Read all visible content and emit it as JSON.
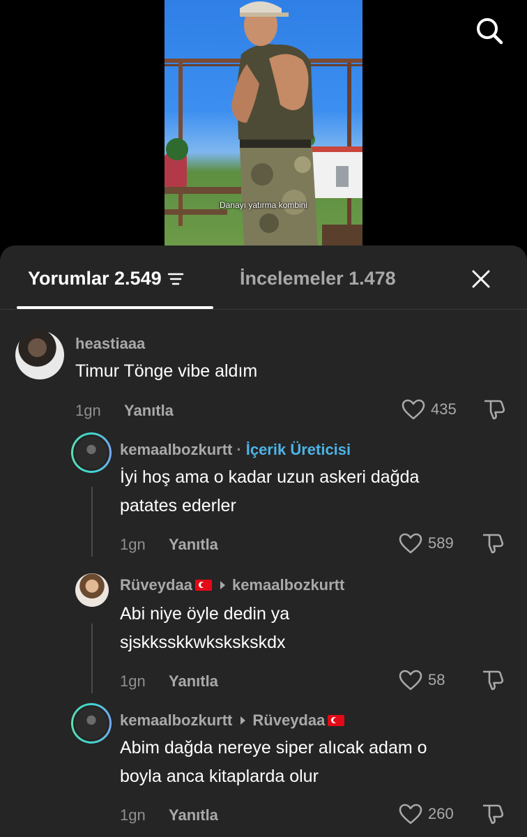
{
  "video": {
    "caption": "Danayı yatırma kombini"
  },
  "icons": {
    "search": "search-icon",
    "close": "close-icon",
    "filter": "filter-icon",
    "heart": "heart-icon",
    "dislike": "dislike-icon"
  },
  "tabs": {
    "comments_label": "Yorumlar 2.549",
    "reviews_label": "İncelemeler 1.478"
  },
  "comments": [
    {
      "username": "heastiaaa",
      "text": "Timur Tönge vibe aldım",
      "time": "1gn",
      "reply_label": "Yanıtla",
      "likes": "435"
    },
    {
      "username": "kemaalbozkurtt",
      "creator_label": "İçerik Üreticisi",
      "text_line1": "İyi hoş ama o kadar uzun askeri dağda",
      "text_line2": "patates ederler",
      "time": "1gn",
      "reply_label": "Yanıtla",
      "likes": "589"
    },
    {
      "username": "Rüveydaa",
      "reply_to": "kemaalbozkurtt",
      "text_line1": "Abi niye öyle dedin ya",
      "text_line2": "sjskksskkwkskskskdx",
      "time": "1gn",
      "reply_label": "Yanıtla",
      "likes": "58"
    },
    {
      "username": "kemaalbozkurtt",
      "reply_to": "Rüveydaa",
      "text_line1": "Abim dağda nereye siper alıcak adam o",
      "text_line2": "boyla anca kitaplarda olur",
      "time": "1gn",
      "reply_label": "Yanıtla",
      "likes": "260"
    }
  ],
  "colors": {
    "sheet_bg": "#252525",
    "creator_tag": "#4db3e6",
    "muted_text": "#a9a9a9"
  }
}
